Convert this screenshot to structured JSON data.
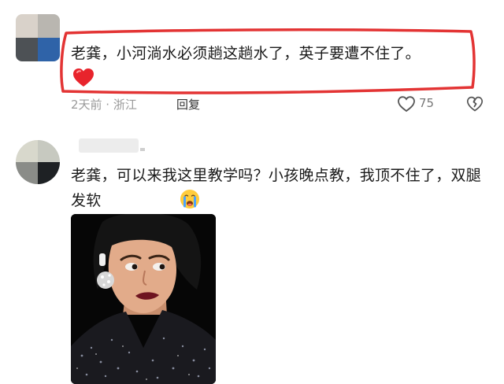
{
  "comments": [
    {
      "author": "",
      "text": "老龚，小河淌水必须趟这趟水了，英子要遭不住了。",
      "emoji": "red-heart",
      "meta": "2天前 · 浙江",
      "reply_label": "回复",
      "likes": "75",
      "highlight_color": "#e33434"
    },
    {
      "author": "",
      "text": "老龚，可以来我这里教学吗？小孩晚点教，我顶不住了，双腿发软",
      "emoji": "crying-face",
      "image": "meme-photo"
    }
  ],
  "colors": {
    "accent_red": "#e33434",
    "meta_gray": "#9a9a9a",
    "text": "#1a1a1a"
  }
}
